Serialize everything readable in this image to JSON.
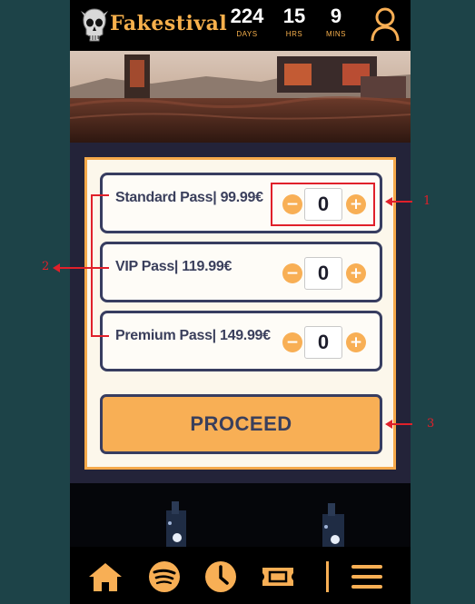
{
  "app": {
    "brand": "Fakestival"
  },
  "countdown": [
    {
      "value": "224",
      "unit": "DAYS"
    },
    {
      "value": "15",
      "unit": "HRS"
    },
    {
      "value": "9",
      "unit": "MINS"
    }
  ],
  "passes": [
    {
      "label": "Standard Pass| 99.99€",
      "quantity": "0",
      "minus": "−",
      "plus": "+"
    },
    {
      "label": "VIP Pass| 119.99€",
      "quantity": "0",
      "minus": "−",
      "plus": "+"
    },
    {
      "label": "Premium Pass| 149.99€",
      "quantity": "0",
      "minus": "−",
      "plus": "+"
    }
  ],
  "proceed_label": "PROCEED",
  "bottom_nav": [
    "home-icon",
    "spotify-icon",
    "clock-icon",
    "ticket-icon",
    "menu-icon"
  ],
  "annotations": [
    "1",
    "2",
    "3"
  ],
  "colors": {
    "accent": "#f8af55",
    "dark_navy": "#232339",
    "border_navy": "#373d60",
    "annotation_red": "#e0202a",
    "page_bg": "#1d4348"
  }
}
